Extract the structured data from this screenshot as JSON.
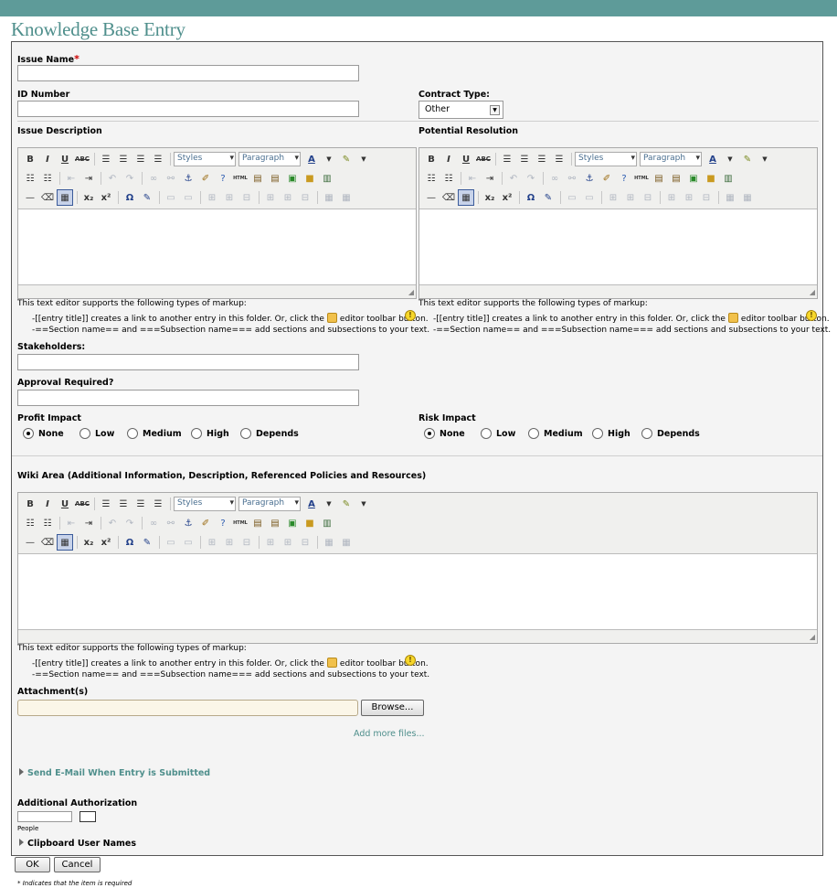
{
  "page": {
    "title": "Knowledge Base Entry"
  },
  "fields": {
    "issue_name": {
      "label": "Issue Name",
      "required_mark": "*",
      "value": ""
    },
    "id_number": {
      "label": "ID Number",
      "value": ""
    },
    "contract_type": {
      "label": "Contract Type:",
      "value": "Other"
    },
    "issue_description": {
      "label": "Issue Description"
    },
    "potential_resolution": {
      "label": "Potential Resolution"
    },
    "stakeholders": {
      "label": "Stakeholders:",
      "value": ""
    },
    "approval_required": {
      "label": "Approval Required?",
      "value": ""
    },
    "profit_impact": {
      "label": "Profit Impact",
      "options": [
        "None",
        "Low",
        "Medium",
        "High",
        "Depends"
      ],
      "selected": "None"
    },
    "risk_impact": {
      "label": "Risk Impact",
      "options": [
        "None",
        "Low",
        "Medium",
        "High",
        "Depends"
      ],
      "selected": "None"
    },
    "wiki_area": {
      "label": "Wiki Area (Additional Information, Description, Referenced Policies and Resources)"
    }
  },
  "editor": {
    "styles_dropdown": "Styles",
    "format_dropdown": "Paragraph",
    "help_intro": "This text editor supports the following types of markup:",
    "help_link_prefix": "-[[entry title]] creates a link to another entry in this folder. Or, click the",
    "help_link_suffix": "editor toolbar button.",
    "help_sections": "-==Section name== and ===Subsection name=== add sections and subsections to your text.",
    "toolbar_row1": [
      "bold-icon",
      "italic-icon",
      "underline-icon",
      "strikethrough-icon",
      "align-left-icon",
      "align-center-icon",
      "align-right-icon",
      "align-justify-icon",
      "text-color-icon",
      "highlight-color-icon"
    ],
    "toolbar_glyphs": {
      "bold": "B",
      "italic": "I",
      "underline": "U",
      "strike": "ABC",
      "html": "HTML",
      "omega": "Ω",
      "sub": "x₂",
      "sup": "x²"
    }
  },
  "attachments": {
    "label": "Attachment(s)",
    "browse": "Browse...",
    "add_more": "Add more files..."
  },
  "send_email": {
    "label": "Send E-Mail When Entry is Submitted"
  },
  "additional_auth": {
    "label": "Additional Authorization",
    "people_label": "People",
    "clipboard": "Clipboard User Names"
  },
  "buttons": {
    "ok": "OK",
    "cancel": "Cancel"
  },
  "footnote": "* Indicates that the item is required",
  "colors": {
    "accent": "#5e9b99",
    "title": "#4f8f8c",
    "panel": "#f4f4f4"
  }
}
